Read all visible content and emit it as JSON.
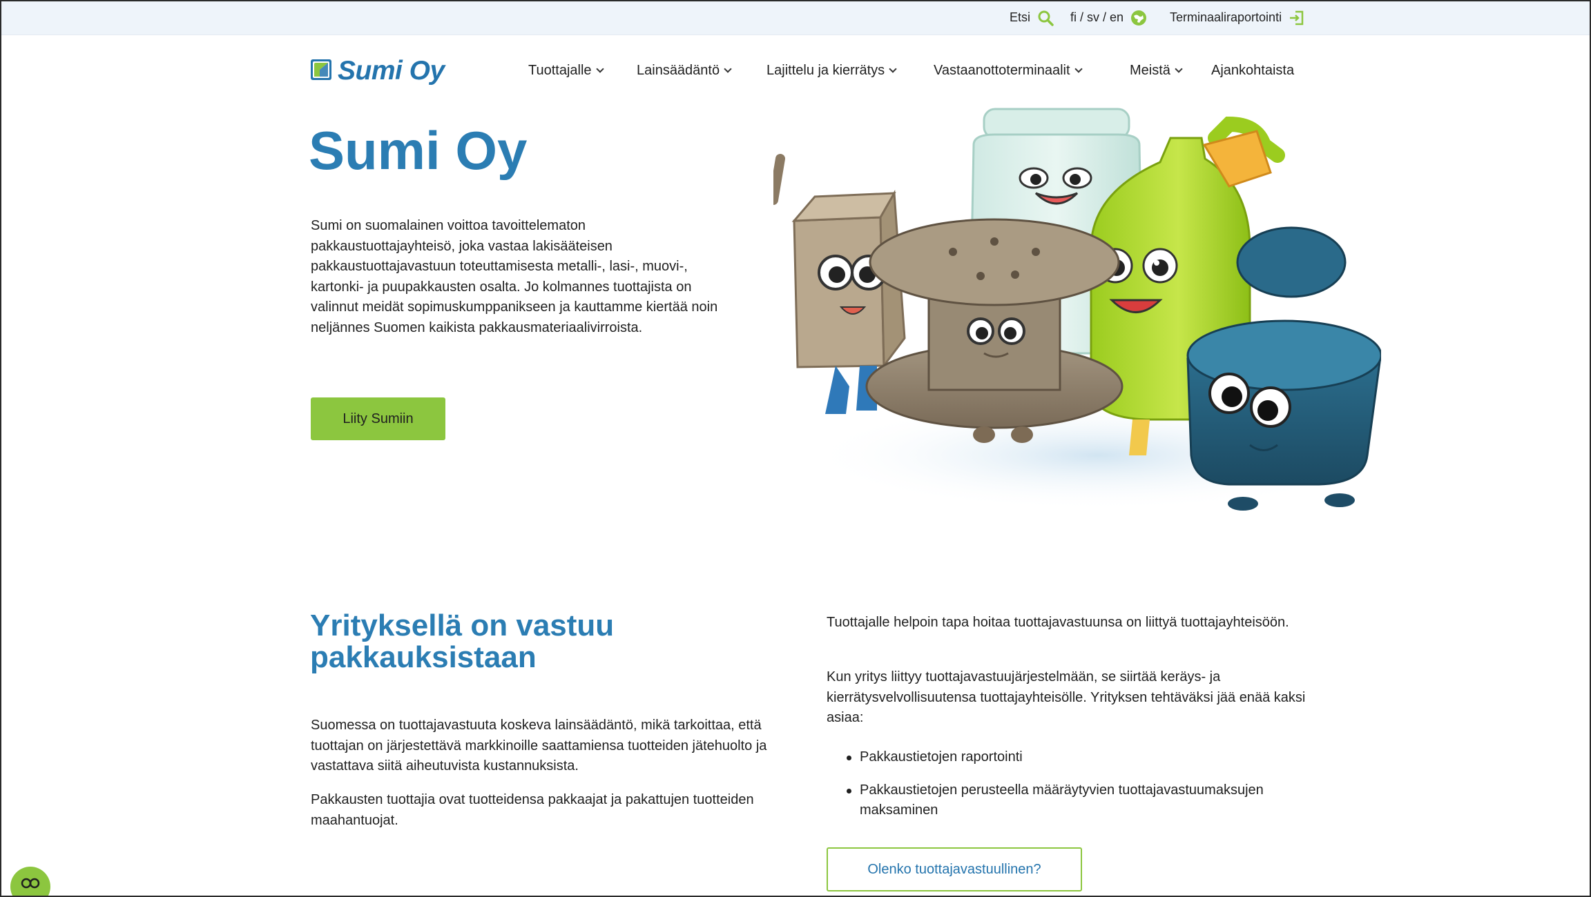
{
  "utility": {
    "search_label": "Etsi",
    "language_label": "fi / sv / en",
    "terminal_label": "Terminaaliraportointi"
  },
  "header": {
    "logo_text": "Sumi Oy",
    "nav": [
      {
        "label": "Tuottajalle",
        "has_dropdown": true
      },
      {
        "label": "Lainsäädäntö",
        "has_dropdown": true
      },
      {
        "label": "Lajittelu ja kierrätys",
        "has_dropdown": true
      },
      {
        "label": "Vastaanottoterminaalit",
        "has_dropdown": true
      },
      {
        "label": "Meistä",
        "has_dropdown": true
      },
      {
        "label": "Ajankohtaista",
        "has_dropdown": false
      }
    ]
  },
  "hero": {
    "title": "Sumi Oy",
    "text": "Sumi on suomalainen voittoa tavoittelematon pakkaustuottajayhteisö, joka vastaa lakisääteisen pakkaustuottajavastuun toteuttamisesta metalli-, lasi-, muovi-, kartonki- ja puupakkausten osalta. Jo kolmannes tuottajista on valinnut meidät sopimuskumppanikseen ja kauttamme kiertää noin neljännes Suomen kaikista pakkausmateriaalivirroista.",
    "cta_label": "Liity Sumiin"
  },
  "responsibility": {
    "title": "Yrityksellä on vastuu pakkauksistaan",
    "left_paragraphs": [
      "Suomessa on tuottajavastuuta koskeva lainsäädäntö, mikä tarkoittaa, että tuottajan on järjestettävä markkinoille saattamiensa tuotteiden jätehuolto ja vastattava siitä aiheutuvista kustannuksista.",
      "Pakkausten tuottajia ovat tuotteidensa pakkaajat ja pakattujen tuotteiden maahantuojat."
    ],
    "right_paragraphs": [
      "Tuottajalle helpoin tapa hoitaa tuottajavastuunsa on liittyä tuottajayhteisöön.",
      "Kun yritys liittyy tuottajavastuujärjestelmään, se siirtää keräys- ja kierrätysvelvollisuutensa tuottajayhteisölle. Yrityksen tehtäväksi jää enää kaksi asiaa:"
    ],
    "bullets": [
      "Pakkaustietojen raportointi",
      "Pakkaustietojen perusteella määräytyvien tuottajavastuumaksujen maksaminen"
    ],
    "cta_label": "Olenko tuottajavastuullinen?"
  },
  "colors": {
    "brand_blue": "#2b7db3",
    "brand_green": "#8cc63f",
    "utility_bg": "#eef4fa"
  },
  "icons": {
    "search": "search-icon",
    "language": "globe-icon",
    "terminal": "login-icon",
    "cookie": "cookie-settings-icon"
  }
}
